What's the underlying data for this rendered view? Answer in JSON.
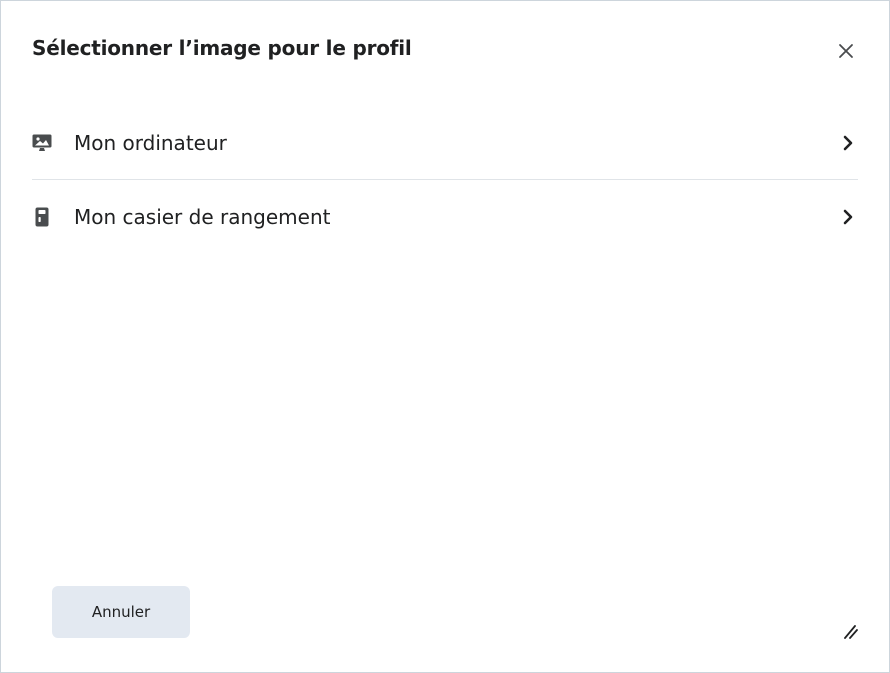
{
  "dialog": {
    "title": "Sélectionner l’image pour le profil",
    "close_icon": "close-icon"
  },
  "options": [
    {
      "label": "Mon ordinateur",
      "icon": "computer-image-icon"
    },
    {
      "label": "Mon casier de rangement",
      "icon": "locker-icon"
    }
  ],
  "footer": {
    "cancel_label": "Annuler"
  },
  "colors": {
    "border": "#cdd5dc",
    "divider": "#e0e4e8",
    "button_bg": "#e3e9f1",
    "text": "#202122",
    "icon": "#494c4e"
  }
}
